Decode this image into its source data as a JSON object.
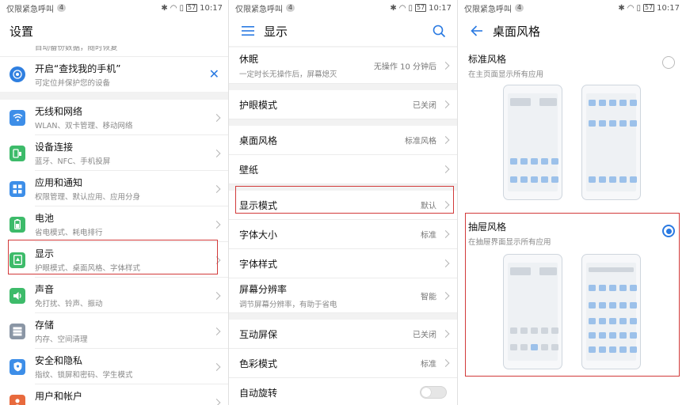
{
  "status": {
    "carrier": "仅限紧急呼叫",
    "sim_badge": "4",
    "battery": "57",
    "time": "10:17"
  },
  "panel1": {
    "title": "设置",
    "partial_top_text": "自动备份数据，随时恢复",
    "find_phone": {
      "title": "开启“查找我的手机”",
      "sub": "可定位并保护您的设备"
    },
    "items": [
      {
        "title": "无线和网络",
        "sub": "WLAN、双卡管理、移动网络",
        "color": "#3d8ee8",
        "icon": "wifi-icon"
      },
      {
        "title": "设备连接",
        "sub": "蓝牙、NFC、手机投屏",
        "color": "#3dbb6a",
        "icon": "device-connect-icon"
      },
      {
        "title": "应用和通知",
        "sub": "权限管理、默认应用、应用分身",
        "color": "#3d8ee8",
        "icon": "apps-icon"
      },
      {
        "title": "电池",
        "sub": "省电模式、耗电排行",
        "color": "#3dbb6a",
        "icon": "battery-icon"
      },
      {
        "title": "显示",
        "sub": "护眼模式、桌面风格、字体样式",
        "color": "#3dbb6a",
        "icon": "display-icon"
      },
      {
        "title": "声音",
        "sub": "免打扰、铃声、振动",
        "color": "#3dbb6a",
        "icon": "sound-icon"
      },
      {
        "title": "存储",
        "sub": "内存、空间清理",
        "color": "#8a96a5",
        "icon": "storage-icon"
      },
      {
        "title": "安全和隐私",
        "sub": "指纹、锁屏和密码、学生模式",
        "color": "#3d8ee8",
        "icon": "shield-icon"
      },
      {
        "title": "用户和帐户",
        "sub": "用户、云帐户、帐户",
        "color": "#e86a3d",
        "icon": "user-icon"
      }
    ]
  },
  "panel2": {
    "title": "显示",
    "sleep": {
      "title": "休眠",
      "sub": "一定时长无操作后，屏幕熄灭",
      "value": "无操作 10 分钟后"
    },
    "eye": {
      "title": "护眼模式",
      "value": "已关闭"
    },
    "desktop_style": {
      "title": "桌面风格",
      "value": "标准风格"
    },
    "wallpaper": {
      "title": "壁纸"
    },
    "display_mode": {
      "title": "显示模式",
      "value": "默认"
    },
    "font_size": {
      "title": "字体大小",
      "value": "标准"
    },
    "font_style": {
      "title": "字体样式"
    },
    "resolution": {
      "title": "屏幕分辨率",
      "sub": "调节屏幕分辨率，有助于省电",
      "value": "智能"
    },
    "screensaver": {
      "title": "互动屏保",
      "value": "已关闭"
    },
    "color_mode": {
      "title": "色彩模式",
      "value": "标准"
    },
    "auto_rotate": {
      "title": "自动旋转"
    }
  },
  "panel3": {
    "title": "桌面风格",
    "standard": {
      "title": "标准风格",
      "sub": "在主页面显示所有应用",
      "selected": false
    },
    "drawer": {
      "title": "抽屉风格",
      "sub": "在抽屉界面显示所有应用",
      "selected": true
    },
    "accent": "#2a7ae2",
    "highlight": "#d23a3a"
  }
}
